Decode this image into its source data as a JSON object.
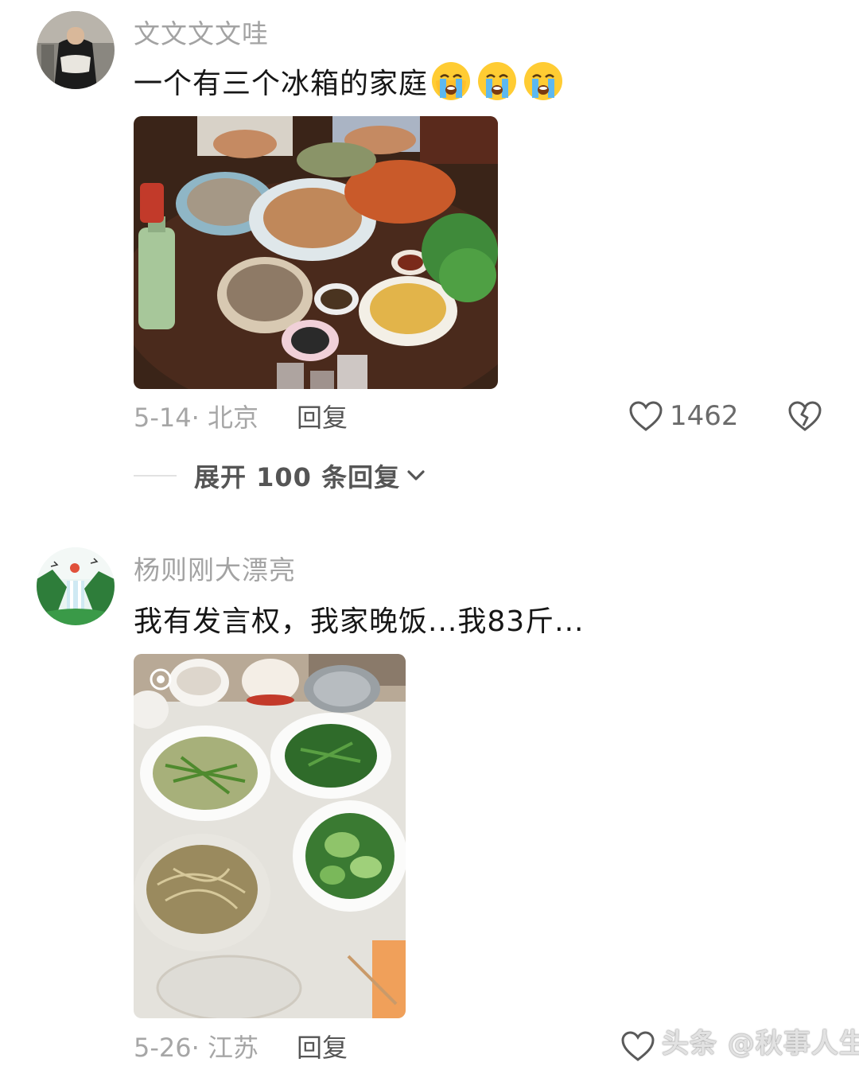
{
  "comments": [
    {
      "username": "文文文文哇",
      "text": "一个有三个冰箱的家庭",
      "emojis": [
        "loudly-crying-face",
        "loudly-crying-face",
        "loudly-crying-face"
      ],
      "date_location": "5-14· 北京",
      "reply_label": "回复",
      "like_count": "1462",
      "photo_subject": "rich seafood dinner table"
    },
    {
      "username": "杨则刚大漂亮",
      "text": "我有发言权，我家晚饭...我83斤...",
      "date_location": "5-26· 江苏",
      "reply_label": "回复",
      "photo_subject": "simple vegetable dinner table"
    }
  ],
  "expand_replies": {
    "label": "展开 100 条回复",
    "icon": "chevron-down-icon"
  },
  "watermark": "头条 @秋事人生",
  "colors": {
    "username": "#a3a3a3",
    "meta": "#a6a6a6",
    "reply": "#555555",
    "text": "#161616"
  }
}
